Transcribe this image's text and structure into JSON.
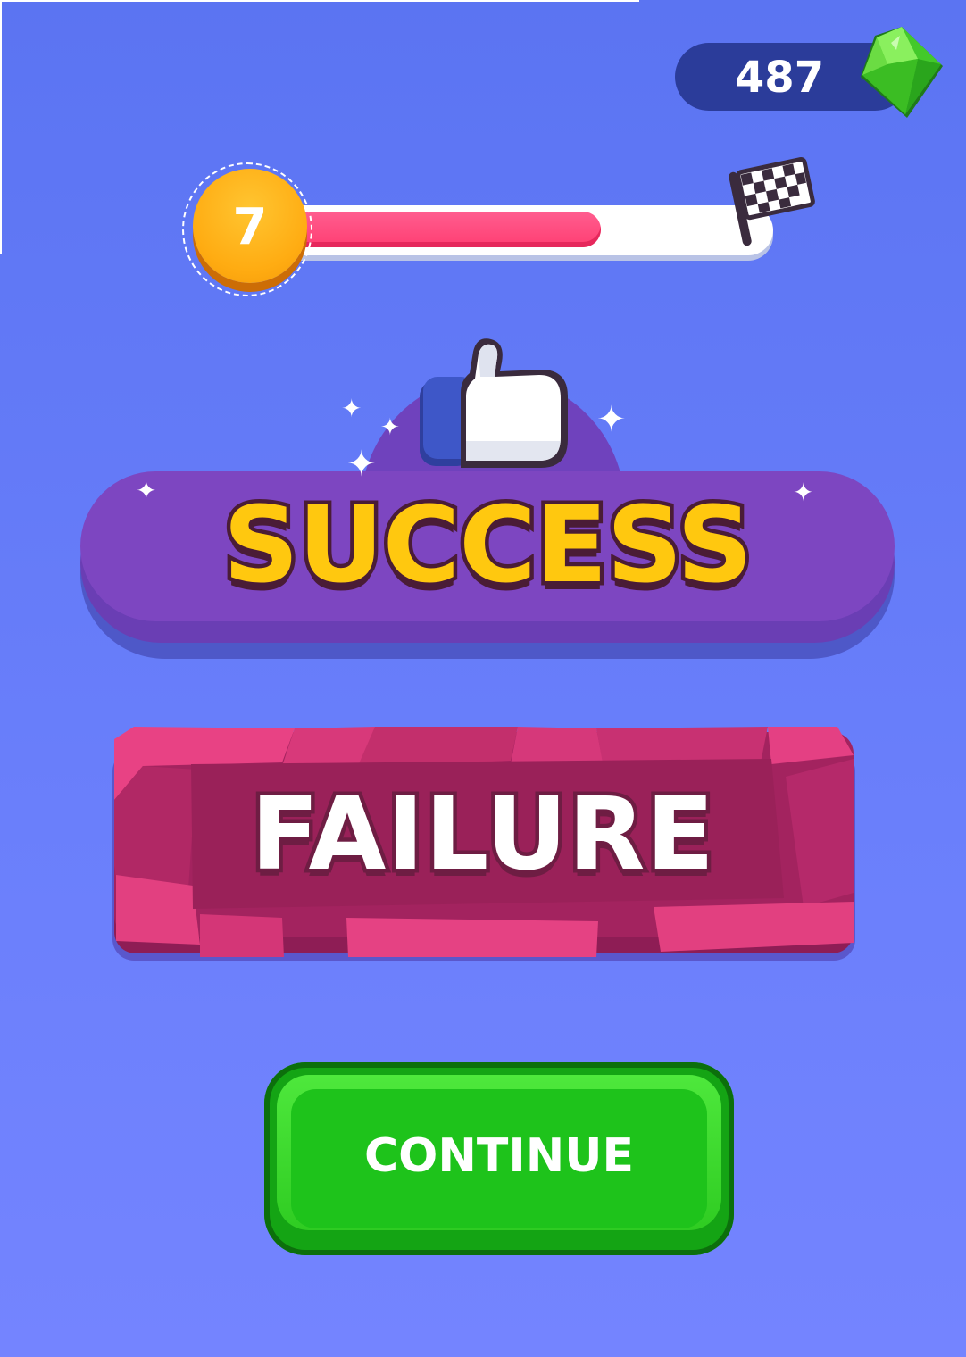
{
  "hud": {
    "gems": "487",
    "level": "7",
    "level_progress": 0.66,
    "gem_icon": "green-gem-icon",
    "finish_icon": "checkered-flag-icon"
  },
  "success_banner": {
    "title": "SUCCESS",
    "icon": "thumbs-up-icon"
  },
  "failure_banner": {
    "title": "FAILURE"
  },
  "actions": {
    "continue_label": "CONTINUE"
  },
  "colors": {
    "background": "#6a7ffb",
    "progress_fill": "#ff3e72",
    "success_text": "#ffc80f",
    "success_plate": "#7d46c1",
    "failure_plate": "#a3235f",
    "continue_button": "#1ec31b"
  }
}
